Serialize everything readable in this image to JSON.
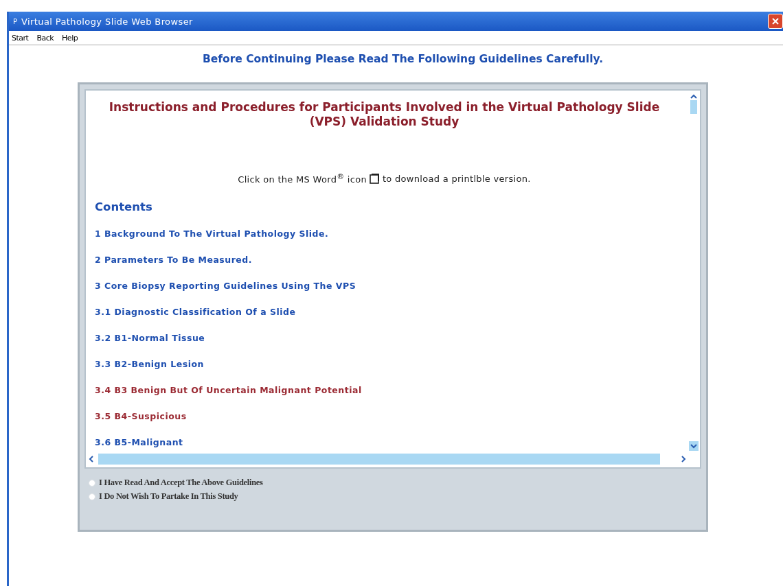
{
  "window": {
    "title": "Virtual Pathology Slide Web Browser",
    "app_letter": "P"
  },
  "menu": [
    "Start",
    "Back",
    "Help"
  ],
  "heading": "Before Continuing Please Read The Following Guidelines Carefully.",
  "document": {
    "title": "Instructions and Procedures for Participants Involved in the Virtual Pathology Slide (VPS) Validation Study",
    "note_before": "Click on the MS Word$^{®}$ icon",
    "note_after": "to download a printlble version.",
    "contents_heading": "Contents",
    "contents": [
      {
        "label": "1 Background To The Virtual Pathology Slide.",
        "visited": false
      },
      {
        "label": "2 Parameters To Be Measured.",
        "visited": false
      },
      {
        "label": "3 Core Biopsy Reporting Guidelines Using The VPS",
        "visited": false
      },
      {
        "label": "3.1 Diagnostic Classification Of a Slide",
        "visited": false
      },
      {
        "label": "3.2 B1-Normal Tissue",
        "visited": false
      },
      {
        "label": "3.3 B2-Benign Lesion",
        "visited": false
      },
      {
        "label": "3.4 B3 Benign But Of Uncertain Malignant Potential",
        "visited": true
      },
      {
        "label": "3.5 B4-Suspicious",
        "visited": true
      },
      {
        "label": "3.6 B5-Malignant",
        "visited": false
      }
    ]
  },
  "options": [
    {
      "label": "I Have Read And Accept The Above Guidelines",
      "selected": false
    },
    {
      "label": "I Do Not Wish To Partake In This Study",
      "selected": false
    }
  ]
}
